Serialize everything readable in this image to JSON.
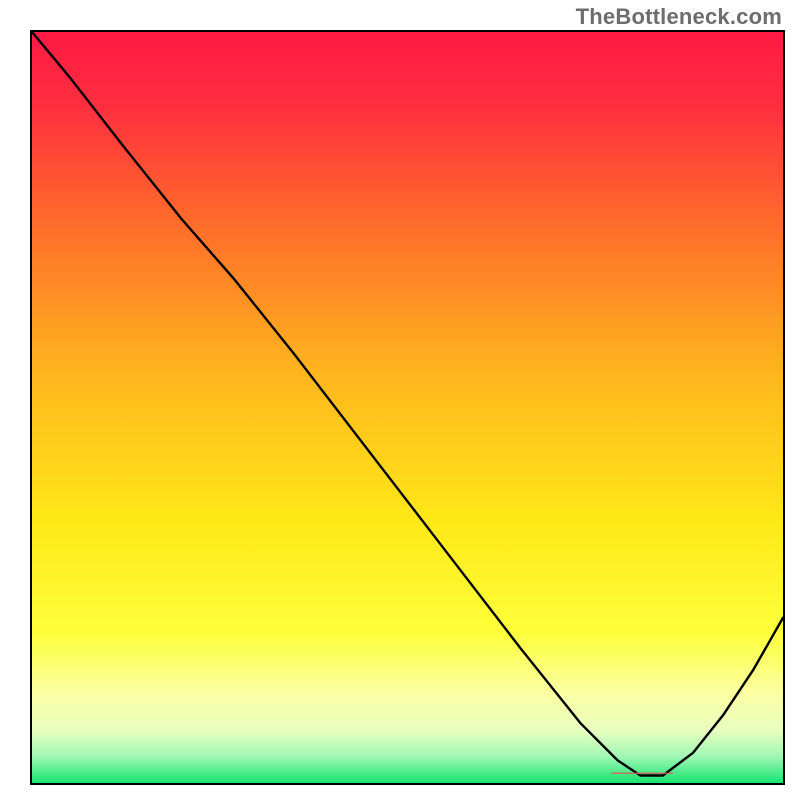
{
  "watermark": "TheBottleneck.com",
  "chart_data": {
    "type": "line",
    "title": "",
    "xlabel": "",
    "ylabel": "",
    "xlim": [
      0,
      100
    ],
    "ylim": [
      0,
      100
    ],
    "grid": false,
    "legend": false,
    "background_gradient_stops": [
      {
        "offset": 0.0,
        "color": "#ff1a44"
      },
      {
        "offset": 0.1,
        "color": "#ff2f3f"
      },
      {
        "offset": 0.25,
        "color": "#ff6a2b"
      },
      {
        "offset": 0.45,
        "color": "#ffb41e"
      },
      {
        "offset": 0.65,
        "color": "#ffe817"
      },
      {
        "offset": 0.8,
        "color": "#feff3a"
      },
      {
        "offset": 0.88,
        "color": "#fbffa2"
      },
      {
        "offset": 0.93,
        "color": "#e8ffbf"
      },
      {
        "offset": 0.965,
        "color": "#9ff7b4"
      },
      {
        "offset": 1.0,
        "color": "#16e46f"
      }
    ],
    "series": [
      {
        "name": "bottleneck-curve",
        "x": [
          0,
          5,
          12,
          20,
          27,
          35,
          45,
          55,
          65,
          73,
          78,
          81,
          84,
          88,
          92,
          96,
          100
        ],
        "y": [
          100,
          94,
          85,
          75,
          67,
          57,
          44,
          31,
          18,
          8,
          3,
          1,
          1,
          4,
          9,
          15,
          22
        ]
      }
    ],
    "marker": {
      "name": "optimal-range",
      "x_start": 77.2,
      "x_end": 85.3,
      "y": 1.3,
      "color": "#d0625a",
      "thickness_pct": 1.2
    }
  }
}
